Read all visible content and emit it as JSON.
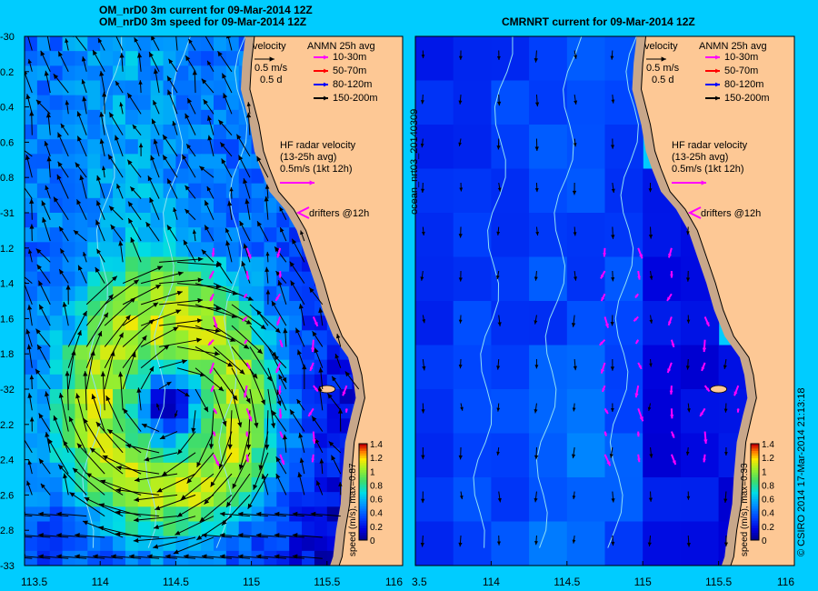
{
  "titles": {
    "left_line1": "OM_nrD0 3m current for 09-Mar-2014 12Z",
    "left_line2": "OM_nrD0 3m speed for 09-Mar-2014 12Z",
    "right_line1": "CMRNRT current for 09-Mar-2014 12Z"
  },
  "side_labels": {
    "right_panel_vertical": "ocean_nrt03_20140309",
    "credit_vertical": "© CSIRO 2014  17-Mar-2014 21:13:18"
  },
  "colors": {
    "page_bg": "#00ccff",
    "land": "#fdc895",
    "shelf_rock": "#c8a78a",
    "contour": "#8fe0f5",
    "arrow": "#000000",
    "hf_radar_arrow": "#ff00ff",
    "anmn_10_30": "#ff00ff",
    "anmn_50_70": "#ff0000",
    "anmn_80_120": "#0000ff",
    "anmn_150_200": "#000000"
  },
  "legend": {
    "velocity_label": "velocity",
    "velocity_scale": "0.5 m/s",
    "velocity_time": "0.5 d",
    "anmn_title": "ANMN 25h avg",
    "anmn_entries": [
      {
        "label": "10-30m",
        "color": "#ff00ff"
      },
      {
        "label": "50-70m",
        "color": "#ff0000"
      },
      {
        "label": "80-120m",
        "color": "#0000ff"
      },
      {
        "label": "150-200m",
        "color": "#000000"
      }
    ],
    "hf_title": "HF radar velocity",
    "hf_avg": "(13-25h avg)",
    "hf_scale": "0.5m/s (1kt 12h)",
    "drifters_label": "drifters @12h"
  },
  "chart_data": [
    {
      "type": "heatmap",
      "title": "OM_nrD0 3m current for 09-Mar-2014 12Z",
      "subtitle": "OM_nrD0 3m speed for 09-Mar-2014 12Z",
      "xlim": [
        113.5,
        116
      ],
      "ylim": [
        -33,
        -30
      ],
      "x_ticks": [
        "113.5",
        "114",
        "114.5",
        "115",
        "115.5",
        "116"
      ],
      "y_ticks": [
        "-30",
        "-30.2",
        "-30.4",
        "-30.6",
        "-30.8",
        "-31",
        "-31.2",
        "-31.4",
        "-31.6",
        "-31.8",
        "-32",
        "-32.2",
        "-32.4",
        "-32.6",
        "-32.8",
        "-33"
      ],
      "y_tick_labels": [
        "-30",
        "0.2",
        "0.4",
        "0.6",
        "0.8",
        "-31",
        "1.2",
        "1.4",
        "1.6",
        "1.8",
        "-32",
        "2.2",
        "2.4",
        "2.6",
        "2.8",
        "-33"
      ],
      "colorbar": {
        "label": "speed (m/s), max=0.87",
        "range": [
          0,
          1.4
        ],
        "ticks": [
          "0",
          "0.2",
          "0.4",
          "0.6",
          "0.8",
          "1",
          "1.2",
          "1.4"
        ]
      },
      "eddy_center": [
        114.55,
        -32.2
      ],
      "max_speed": 0.87
    },
    {
      "type": "heatmap",
      "title": "CMRNRT current for 09-Mar-2014 12Z",
      "xlim": [
        113.5,
        116
      ],
      "ylim": [
        -33,
        -30
      ],
      "x_ticks": [
        "3.5",
        "114",
        "114.5",
        "115",
        "115.5",
        "116"
      ],
      "colorbar": {
        "label": "speed (m/s), max=0.33",
        "range": [
          0,
          1.4
        ],
        "ticks": [
          "0",
          "0.2",
          "0.4",
          "0.6",
          "0.8",
          "1",
          "1.2",
          "1.4"
        ]
      },
      "max_speed": 0.33
    }
  ]
}
